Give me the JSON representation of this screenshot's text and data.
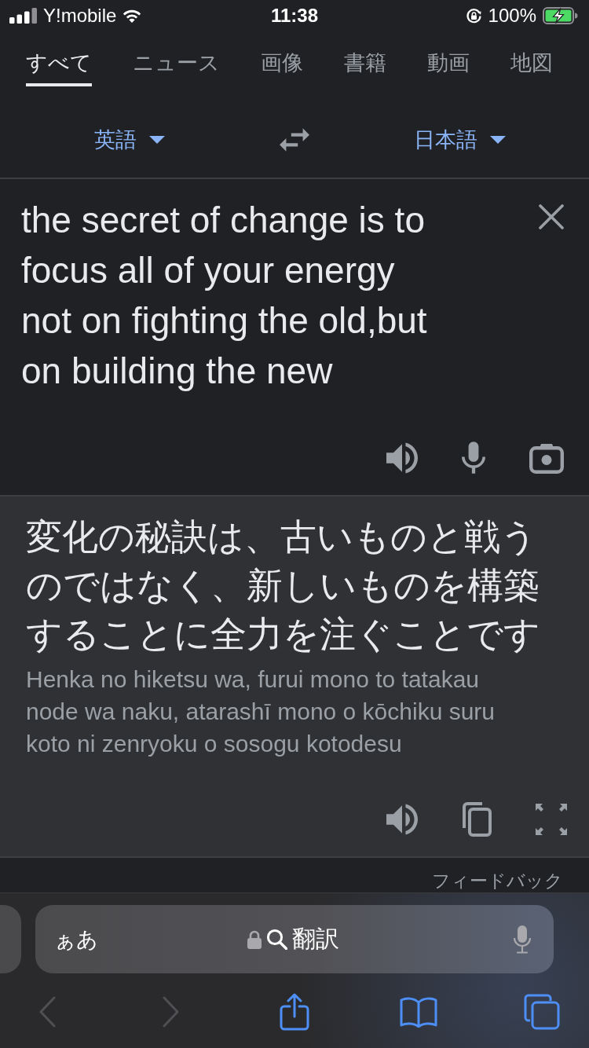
{
  "status_bar": {
    "carrier": "Y!mobile",
    "time": "11:38",
    "battery": "100%"
  },
  "tabs": [
    {
      "label": "すべて",
      "selected": true
    },
    {
      "label": "ニュース",
      "selected": false
    },
    {
      "label": "画像",
      "selected": false
    },
    {
      "label": "書籍",
      "selected": false
    },
    {
      "label": "動画",
      "selected": false
    },
    {
      "label": "地図",
      "selected": false
    }
  ],
  "languages": {
    "source": "英語",
    "target": "日本語"
  },
  "source": {
    "text": "the secret of change is to focus all of your energy not on fighting the old,but on building the new"
  },
  "translation": {
    "text": "変化の秘訣は、古いものと戦うのではなく、新しいものを構築することに全力を注ぐことです",
    "romanization": "Henka no hiketsu wa, furui mono to tatakau node wa naku, atarashī mono o kōchiku suru koto ni zenryoku o sosogu kotodesu"
  },
  "feedback": "フィードバック",
  "address_bar": {
    "text_size_label": "ぁあ",
    "query": "翻訳"
  },
  "navigation": {
    "back": {
      "disabled": true
    },
    "forward": {
      "disabled": true
    }
  }
}
